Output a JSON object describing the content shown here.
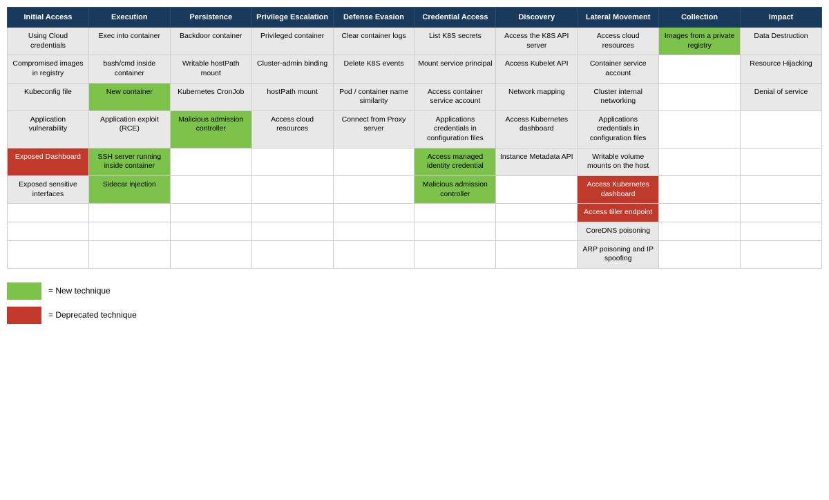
{
  "headers": [
    "Initial Access",
    "Execution",
    "Persistence",
    "Privilege Escalation",
    "Defense Evasion",
    "Credential Access",
    "Discovery",
    "Lateral Movement",
    "Collection",
    "Impact"
  ],
  "rows": [
    [
      {
        "text": "Using Cloud credentials",
        "type": "default"
      },
      {
        "text": "Exec into container",
        "type": "default"
      },
      {
        "text": "Backdoor container",
        "type": "default"
      },
      {
        "text": "Privileged container",
        "type": "default"
      },
      {
        "text": "Clear container logs",
        "type": "default"
      },
      {
        "text": "List K8S secrets",
        "type": "default"
      },
      {
        "text": "Access the K8S API server",
        "type": "default"
      },
      {
        "text": "Access cloud resources",
        "type": "default"
      },
      {
        "text": "Images from a private registry",
        "type": "green"
      },
      {
        "text": "Data Destruction",
        "type": "default"
      }
    ],
    [
      {
        "text": "Compromised images in registry",
        "type": "default"
      },
      {
        "text": "bash/cmd inside container",
        "type": "default"
      },
      {
        "text": "Writable hostPath mount",
        "type": "default"
      },
      {
        "text": "Cluster-admin binding",
        "type": "default"
      },
      {
        "text": "Delete K8S events",
        "type": "default"
      },
      {
        "text": "Mount service principal",
        "type": "default"
      },
      {
        "text": "Access Kubelet API",
        "type": "default"
      },
      {
        "text": "Container service account",
        "type": "default"
      },
      {
        "text": "",
        "type": "white"
      },
      {
        "text": "Resource Hijacking",
        "type": "default"
      }
    ],
    [
      {
        "text": "Kubeconfig file",
        "type": "default"
      },
      {
        "text": "New container",
        "type": "green"
      },
      {
        "text": "Kubernetes CronJob",
        "type": "default"
      },
      {
        "text": "hostPath mount",
        "type": "default"
      },
      {
        "text": "Pod / container name similarity",
        "type": "default"
      },
      {
        "text": "Access container service account",
        "type": "default"
      },
      {
        "text": "Network mapping",
        "type": "default"
      },
      {
        "text": "Cluster internal networking",
        "type": "default"
      },
      {
        "text": "",
        "type": "white"
      },
      {
        "text": "Denial of service",
        "type": "default"
      }
    ],
    [
      {
        "text": "Application vulnerability",
        "type": "default"
      },
      {
        "text": "Application exploit (RCE)",
        "type": "default"
      },
      {
        "text": "Malicious admission controller",
        "type": "green"
      },
      {
        "text": "Access cloud resources",
        "type": "default"
      },
      {
        "text": "Connect from Proxy server",
        "type": "default"
      },
      {
        "text": "Applications credentials in configuration files",
        "type": "default"
      },
      {
        "text": "Access Kubernetes dashboard",
        "type": "default"
      },
      {
        "text": "Applications credentials in configuration files",
        "type": "default"
      },
      {
        "text": "",
        "type": "white"
      },
      {
        "text": "",
        "type": "white"
      }
    ],
    [
      {
        "text": "Exposed Dashboard",
        "type": "red"
      },
      {
        "text": "SSH server running inside container",
        "type": "green"
      },
      {
        "text": "",
        "type": "white"
      },
      {
        "text": "",
        "type": "white"
      },
      {
        "text": "",
        "type": "white"
      },
      {
        "text": "Access managed identity credential",
        "type": "green"
      },
      {
        "text": "Instance Metadata API",
        "type": "default"
      },
      {
        "text": "Writable volume mounts on the host",
        "type": "default"
      },
      {
        "text": "",
        "type": "white"
      },
      {
        "text": "",
        "type": "white"
      }
    ],
    [
      {
        "text": "Exposed sensitive interfaces",
        "type": "default"
      },
      {
        "text": "Sidecar injection",
        "type": "green"
      },
      {
        "text": "",
        "type": "white"
      },
      {
        "text": "",
        "type": "white"
      },
      {
        "text": "",
        "type": "white"
      },
      {
        "text": "Malicious admission controller",
        "type": "green"
      },
      {
        "text": "",
        "type": "white"
      },
      {
        "text": "Access Kubernetes dashboard",
        "type": "red"
      },
      {
        "text": "",
        "type": "white"
      },
      {
        "text": "",
        "type": "white"
      }
    ],
    [
      {
        "text": "",
        "type": "white"
      },
      {
        "text": "",
        "type": "white"
      },
      {
        "text": "",
        "type": "white"
      },
      {
        "text": "",
        "type": "white"
      },
      {
        "text": "",
        "type": "white"
      },
      {
        "text": "",
        "type": "white"
      },
      {
        "text": "",
        "type": "white"
      },
      {
        "text": "Access tiller endpoint",
        "type": "red"
      },
      {
        "text": "",
        "type": "white"
      },
      {
        "text": "",
        "type": "white"
      }
    ],
    [
      {
        "text": "",
        "type": "white"
      },
      {
        "text": "",
        "type": "white"
      },
      {
        "text": "",
        "type": "white"
      },
      {
        "text": "",
        "type": "white"
      },
      {
        "text": "",
        "type": "white"
      },
      {
        "text": "",
        "type": "white"
      },
      {
        "text": "",
        "type": "white"
      },
      {
        "text": "CoreDNS poisoning",
        "type": "default"
      },
      {
        "text": "",
        "type": "white"
      },
      {
        "text": "",
        "type": "white"
      }
    ],
    [
      {
        "text": "",
        "type": "white"
      },
      {
        "text": "",
        "type": "white"
      },
      {
        "text": "",
        "type": "white"
      },
      {
        "text": "",
        "type": "white"
      },
      {
        "text": "",
        "type": "white"
      },
      {
        "text": "",
        "type": "white"
      },
      {
        "text": "",
        "type": "white"
      },
      {
        "text": "ARP poisoning and IP spoofing",
        "type": "default"
      },
      {
        "text": "",
        "type": "white"
      },
      {
        "text": "",
        "type": "white"
      }
    ]
  ],
  "legend": {
    "new_technique": "= New technique",
    "deprecated_technique": "= Deprecated technique"
  }
}
